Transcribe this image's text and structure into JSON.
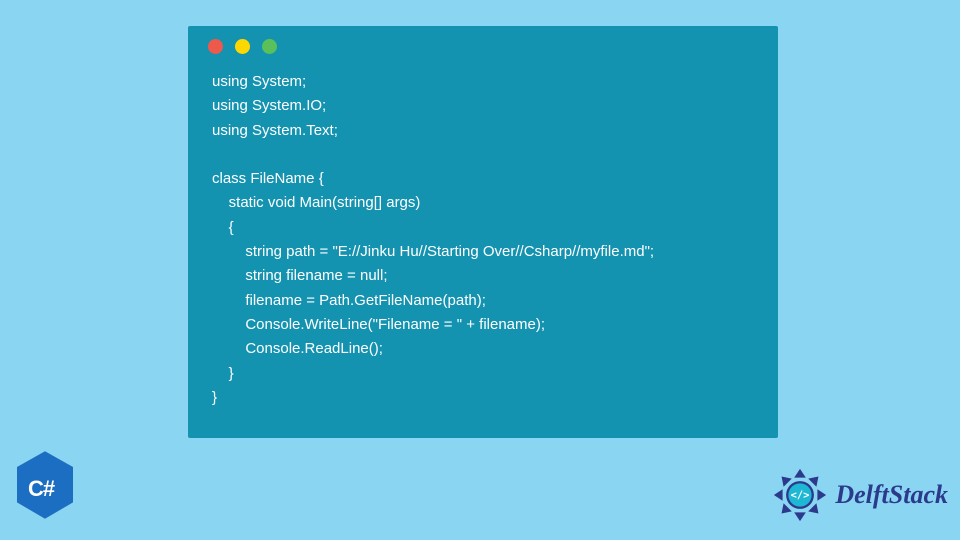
{
  "code": {
    "lines": [
      "using System;",
      "using System.IO;",
      "using System.Text;",
      "",
      "class FileName {",
      "    static void Main(string[] args)",
      "    {",
      "        string path = \"E://Jinku Hu//Starting Over//Csharp//myfile.md\";",
      "        string filename = null;",
      "        filename = Path.GetFileName(path);",
      "        Console.WriteLine(\"Filename = \" + filename);",
      "        Console.ReadLine();",
      "    }",
      "}"
    ]
  },
  "badges": {
    "csharp_label": "C#",
    "delft_label": "DelftStack"
  },
  "colors": {
    "background": "#89d5f2",
    "window": "#1493b1",
    "csharp_badge": "#1b6ec2",
    "delft_accent": "#2c3a8c"
  }
}
